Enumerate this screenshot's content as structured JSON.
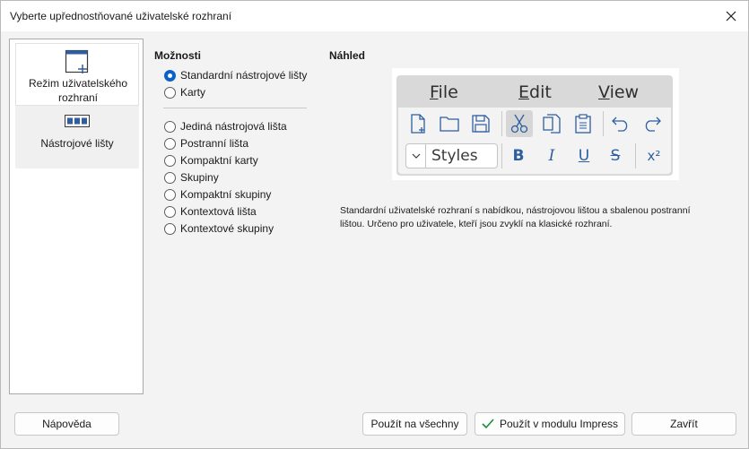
{
  "window": {
    "title": "Vyberte upřednostňované uživatelské rozhraní",
    "close_icon": "close-icon"
  },
  "sidebar": {
    "items": [
      {
        "label": "Režim uživatelského rozhraní",
        "icon": "window-plus-icon",
        "active": true
      },
      {
        "label": "Nástrojové lišty",
        "icon": "toolbar-icon",
        "active": false
      }
    ]
  },
  "options": {
    "heading": "Možnosti",
    "group1": [
      {
        "label": "Standardní nástrojové lišty",
        "checked": true
      },
      {
        "label": "Karty",
        "checked": false
      }
    ],
    "group2": [
      {
        "label": "Jediná nástrojová lišta",
        "checked": false
      },
      {
        "label": "Postranní lišta",
        "checked": false
      },
      {
        "label": "Kompaktní karty",
        "checked": false
      },
      {
        "label": "Skupiny",
        "checked": false
      },
      {
        "label": "Kompaktní skupiny",
        "checked": false
      },
      {
        "label": "Kontextová lišta",
        "checked": false
      },
      {
        "label": "Kontextové skupiny",
        "checked": false
      }
    ]
  },
  "preview": {
    "heading": "Náhled",
    "menu": [
      {
        "label": "File",
        "underline": "F"
      },
      {
        "label": "Edit",
        "underline": "E"
      },
      {
        "label": "View",
        "underline": "V"
      }
    ],
    "styles_label": "Styles",
    "format": {
      "bold": "B",
      "italic": "I",
      "underline": "U",
      "strike": "S",
      "superscript": "x²"
    },
    "accent_color": "#2d5fa0"
  },
  "description": "Standardní uživatelské rozhraní s nabídkou, nástrojovou lištou a sbalenou postranní lištou. Určeno pro uživatele, kteří jsou zvyklí na klasické rozhraní.",
  "buttons": {
    "help": "Nápověda",
    "apply_all": "Použít na všechny",
    "apply_module": "Použít v modulu Impress",
    "close": "Zavřít"
  },
  "colors": {
    "radio_checked": "#0a62c9",
    "check_green": "#1e8c3a"
  }
}
